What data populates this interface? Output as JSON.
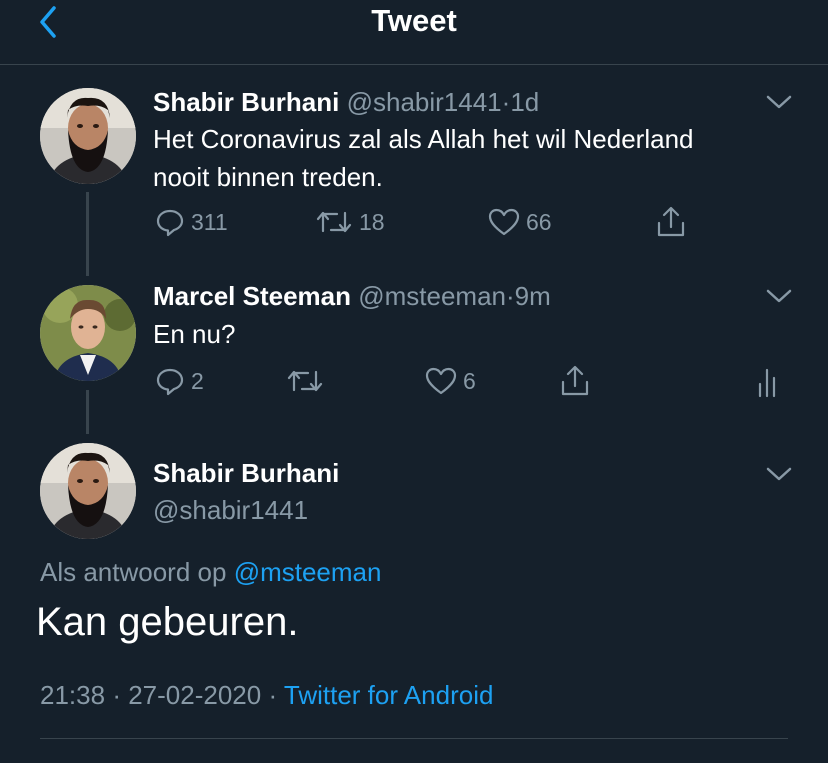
{
  "header": {
    "title": "Tweet"
  },
  "tweets": [
    {
      "name": "Shabir Burhani",
      "handle": "@shabir1441",
      "sep": "·",
      "time": "1d",
      "text_lines": [
        "Het Coronavirus zal als Allah het wil Nederland",
        "nooit binnen treden."
      ],
      "replies": "311",
      "retweets": "18",
      "likes": "66"
    },
    {
      "name": "Marcel Steeman",
      "handle": "@msteeman",
      "sep": "·",
      "time": "9m",
      "text_lines": [
        "En nu?"
      ],
      "replies": "2",
      "retweets": "",
      "likes": "6"
    }
  ],
  "main_tweet": {
    "name": "Shabir Burhani",
    "handle": "@shabir1441",
    "reply_prefix": "Als antwoord op",
    "reply_to": "@msteeman",
    "text": "Kan gebeuren.",
    "time": "21:38",
    "sep1": "·",
    "date": "27-02-2020",
    "sep2": "·",
    "source": "Twitter for Android"
  },
  "icons": {
    "back": "chevron-left-icon",
    "more": "chevron-down-icon",
    "reply": "reply-icon",
    "retweet": "retweet-icon",
    "like": "heart-icon",
    "share": "share-icon",
    "analytics": "analytics-icon"
  },
  "colors": {
    "background": "#15202b",
    "accent": "#1da1f2",
    "muted": "#8899a6",
    "divider": "#38444d"
  }
}
